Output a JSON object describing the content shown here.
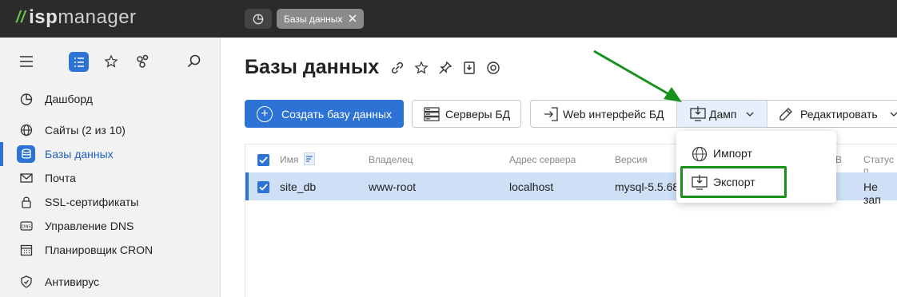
{
  "app": {
    "logo_slash": "//",
    "logo_isp": "isp",
    "logo_manager": "manager",
    "active_tab": "Базы данных"
  },
  "sidebar": {
    "items": [
      {
        "label": "Дашборд",
        "icon": "dashboard-icon"
      },
      {
        "label": "Сайты (2 из 10)",
        "icon": "globe-icon"
      },
      {
        "label": "Базы данных",
        "icon": "database-icon",
        "active": true
      },
      {
        "label": "Почта",
        "icon": "mail-icon"
      },
      {
        "label": "SSL-сертификаты",
        "icon": "lock-icon"
      },
      {
        "label": "Управление DNS",
        "icon": "dns-icon"
      },
      {
        "label": "Планировщик CRON",
        "icon": "calendar-icon"
      },
      {
        "label": "Антивирус",
        "icon": "shield-icon"
      }
    ]
  },
  "main": {
    "title": "Базы данных",
    "toolbar": {
      "create_label": "Создать базу данных",
      "servers_label": "Серверы БД",
      "web_label": "Web интерфейс БД",
      "dump_label": "Дамп",
      "edit_label": "Редактировать"
    },
    "table": {
      "columns": [
        "Имя",
        "Владелец",
        "Адрес сервера",
        "Версия",
        "В",
        "Статус п"
      ],
      "rows": [
        {
          "name": "site_db",
          "owner": "www-root",
          "server": "localhost",
          "version": "mysql-5.5.68",
          "status": "Не зап"
        }
      ]
    },
    "dump_menu": {
      "import_label": "Импорт",
      "export_label": "Экспорт"
    }
  },
  "colors": {
    "accent": "#2d73d5",
    "highlight_green": "#19911d",
    "topbar": "#2b2b2b",
    "sidebar": "#f2f2f2"
  }
}
